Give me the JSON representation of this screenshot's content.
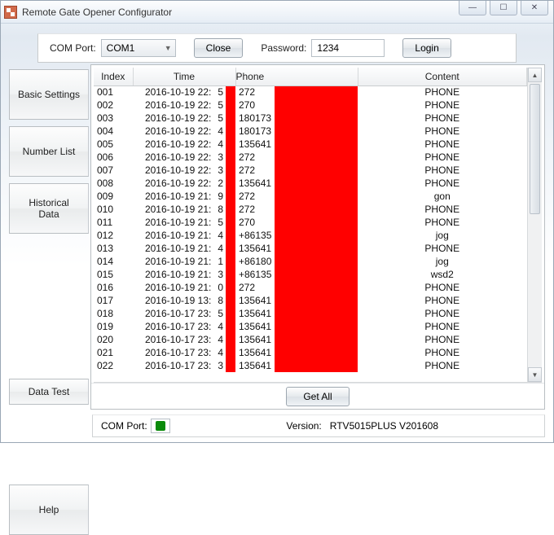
{
  "window": {
    "title": "Remote Gate Opener Configurator"
  },
  "toolbar": {
    "com_port_label": "COM Port:",
    "com_port_value": "COM1",
    "close_label": "Close",
    "password_label": "Password:",
    "password_value": "1234",
    "login_label": "Login"
  },
  "tabs": {
    "basic": "Basic Settings",
    "number_list": "Number List",
    "historical": "Historical\nData",
    "help": "Help",
    "data_test": "Data Test"
  },
  "table": {
    "headers": {
      "index": "Index",
      "time": "Time",
      "phone": "Phone",
      "content": "Content"
    },
    "rows": [
      {
        "index": "001",
        "time": "2016-10-19 22:",
        "time_tail": "5",
        "phone": "272",
        "content": "PHONE"
      },
      {
        "index": "002",
        "time": "2016-10-19 22:",
        "time_tail": "5",
        "phone": "270",
        "content": "PHONE"
      },
      {
        "index": "003",
        "time": "2016-10-19 22:",
        "time_tail": "5",
        "phone": "180173",
        "content": "PHONE"
      },
      {
        "index": "004",
        "time": "2016-10-19 22:",
        "time_tail": "4",
        "phone": "180173",
        "content": "PHONE"
      },
      {
        "index": "005",
        "time": "2016-10-19 22:",
        "time_tail": "4",
        "phone": "135641",
        "content": "PHONE"
      },
      {
        "index": "006",
        "time": "2016-10-19 22:",
        "time_tail": "3",
        "phone": "272",
        "content": "PHONE"
      },
      {
        "index": "007",
        "time": "2016-10-19 22:",
        "time_tail": "3",
        "phone": "272",
        "content": "PHONE"
      },
      {
        "index": "008",
        "time": "2016-10-19 22:",
        "time_tail": "2",
        "phone": "135641",
        "content": "PHONE"
      },
      {
        "index": "009",
        "time": "2016-10-19 21:",
        "time_tail": "9",
        "phone": "272",
        "content": "gon"
      },
      {
        "index": "010",
        "time": "2016-10-19 21:",
        "time_tail": "8",
        "phone": "272",
        "content": "PHONE"
      },
      {
        "index": "011",
        "time": "2016-10-19 21:",
        "time_tail": "5",
        "phone": "270",
        "content": "PHONE"
      },
      {
        "index": "012",
        "time": "2016-10-19 21:",
        "time_tail": "4",
        "phone": "+86135",
        "content": "jog"
      },
      {
        "index": "013",
        "time": "2016-10-19 21:",
        "time_tail": "4",
        "phone": "135641",
        "content": "PHONE"
      },
      {
        "index": "014",
        "time": "2016-10-19 21:",
        "time_tail": "1",
        "phone": "+86180",
        "content": "jog"
      },
      {
        "index": "015",
        "time": "2016-10-19 21:",
        "time_tail": "3",
        "phone": "+86135",
        "content": "wsd2"
      },
      {
        "index": "016",
        "time": "2016-10-19 21:",
        "time_tail": "0",
        "phone": "272",
        "content": "PHONE"
      },
      {
        "index": "017",
        "time": "2016-10-19 13:",
        "time_tail": "8",
        "phone": "135641",
        "content": "PHONE"
      },
      {
        "index": "018",
        "time": "2016-10-17 23:",
        "time_tail": "5",
        "phone": "135641",
        "content": "PHONE"
      },
      {
        "index": "019",
        "time": "2016-10-17 23:",
        "time_tail": "4",
        "phone": "135641",
        "content": "PHONE"
      },
      {
        "index": "020",
        "time": "2016-10-17 23:",
        "time_tail": "4",
        "phone": "135641",
        "content": "PHONE"
      },
      {
        "index": "021",
        "time": "2016-10-17 23:",
        "time_tail": "4",
        "phone": "135641",
        "content": "PHONE"
      },
      {
        "index": "022",
        "time": "2016-10-17 23:",
        "time_tail": "3",
        "phone": "135641",
        "content": "PHONE"
      }
    ]
  },
  "buttons": {
    "get_all": "Get All"
  },
  "status": {
    "com_port_label": "COM Port:",
    "version_label": "Version:",
    "version_value": "RTV5015PLUS V201608"
  }
}
